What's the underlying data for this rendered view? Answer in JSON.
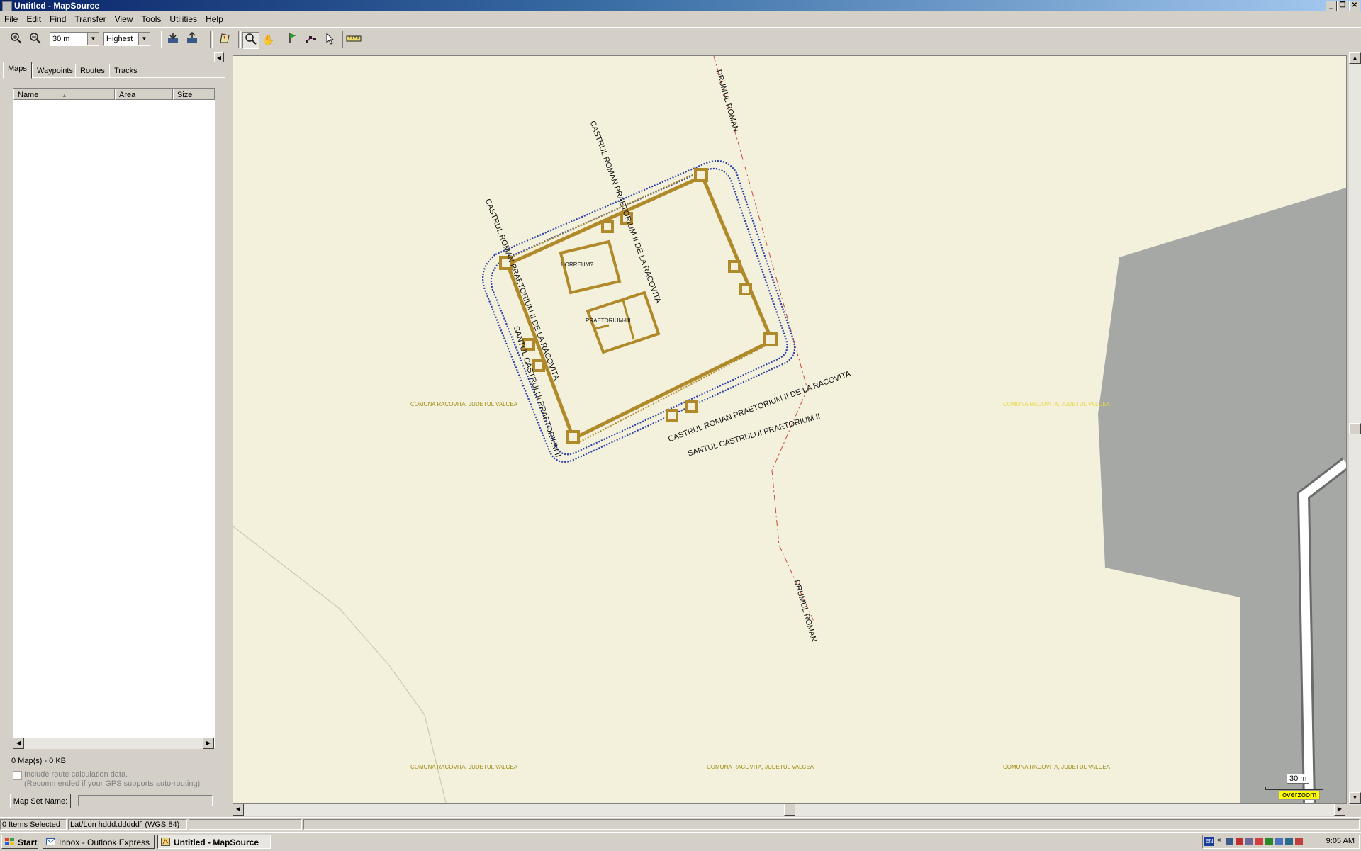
{
  "window": {
    "title": "Untitled - MapSource"
  },
  "menu": [
    "File",
    "Edit",
    "Find",
    "Transfer",
    "View",
    "Tools",
    "Utilities",
    "Help"
  ],
  "toolbar": {
    "zoom_level": "30 m",
    "detail_level": "Highest",
    "icons": [
      "zoom-in-icon",
      "zoom-out-icon",
      "receive-from-device-icon",
      "send-to-device-icon",
      "map-select-icon",
      "zoom-tool-icon",
      "hand-icon",
      "waypoint-tool-icon",
      "route-tool-icon",
      "selection-arrow-icon",
      "measure-icon"
    ]
  },
  "left_panel": {
    "tabs": [
      "Maps",
      "Waypoints",
      "Routes",
      "Tracks"
    ],
    "selected_tab": "Maps",
    "columns": {
      "name": "Name",
      "name_sort": "▲",
      "area": "Area",
      "size": "Size"
    },
    "summary": "0 Map(s) - 0 KB",
    "route_checkbox_label": "Include route calculation data.",
    "route_checkbox_note": "(Recommended if your GPS supports auto-routing)",
    "route_checkbox_checked": false,
    "map_set_button": "Map Set Name:",
    "map_set_value": ""
  },
  "map": {
    "roads": {
      "drumul_top": "DRUMUL ROMAN",
      "drumul_bottom": "DRUMUL ROMAN"
    },
    "structures": {
      "horreum": "HORREUM?",
      "praetorium": "PRAETORIUM-UL",
      "castrum_top": "CASTRUL ROMAN PRAETORIUM II DE LA RACOVITA",
      "castrum_left": "CASTRUL ROMAN PRAETORIUM II DE LA RACOVITA",
      "castrum_bottom": "CASTRUL ROMAN PRAETORIUM II DE LA RACOVITA",
      "santul_left": "SANTUL CASTRULUI PRAETORIUM II",
      "santul_bottom": "SANTUL CASTRULUI PRAETORIUM II"
    },
    "area_labels": [
      "COMUNA RACOVITA, JUDETUL VALCEA",
      "COMUNA RACOVITA, JUDETUL VALCEA",
      "COMUNA RACOVITA, JUDETUL VALCEA",
      "COMUNA RACOVITA, JUDETUL VALCEA",
      "COMUNA RACOVITA, JUDETUL VALCEA"
    ],
    "scale": "30 m",
    "overzoom": "overzoom",
    "colors": {
      "background": "#f3f1dc",
      "structure": "#b08a2a",
      "ditch": "#2a3ea8",
      "road_line": "#c84a3a",
      "area_label": "#a08a10",
      "gray_area": "#a6a8a5"
    }
  },
  "status": {
    "selection": "0 Items Selected",
    "coords": "Lat/Lon hddd.ddddd° (WGS 84)",
    "extra": ""
  },
  "taskbar": {
    "start": "Start",
    "tasks": [
      "Inbox - Outlook Express",
      "Untitled - MapSource"
    ],
    "clock": "9:05 AM",
    "lang": "EN"
  }
}
